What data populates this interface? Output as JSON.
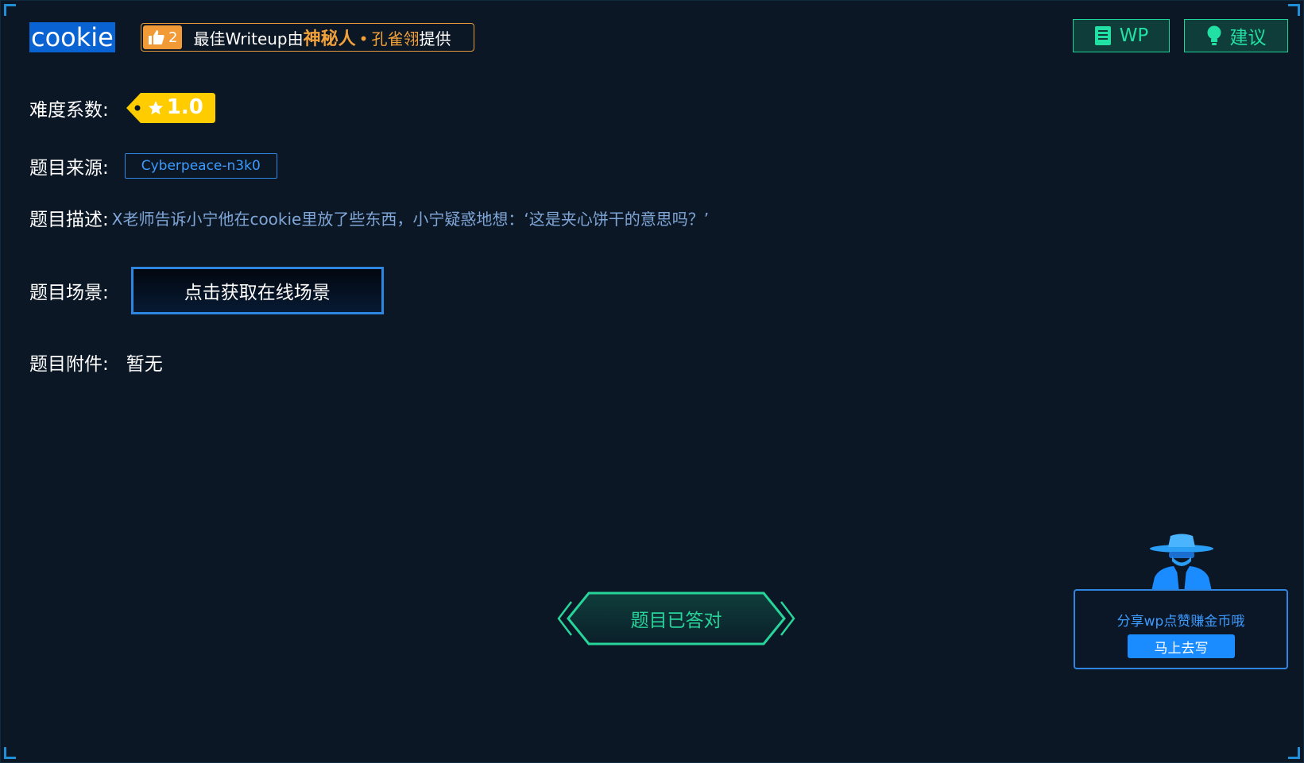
{
  "challenge": {
    "title": "cookie"
  },
  "writeup_banner": {
    "likes": "2",
    "prefix": "最佳Writeup由",
    "author": "神秘人",
    "separator": "•",
    "team": "孔雀翎",
    "suffix": "提供"
  },
  "toolbar": {
    "wp_label": "WP",
    "suggest_label": "建议"
  },
  "fields": {
    "difficulty_label": "难度系数:",
    "difficulty_value": "1.0",
    "source_label": "题目来源:",
    "source_value": "Cyberpeace-n3k0",
    "description_label": "题目描述:",
    "description_value": "X老师告诉小宁他在cookie里放了些东西，小宁疑惑地想：‘这是夹心饼干的意思吗？’",
    "scene_label": "题目场景:",
    "scene_button": "点击获取在线场景",
    "attachment_label": "题目附件:",
    "attachment_value": "暂无"
  },
  "status": {
    "solved_label": "题目已答对"
  },
  "promo": {
    "text": "分享wp点赞赚金币哦",
    "button": "马上去写"
  },
  "colors": {
    "background": "#0c1726",
    "accent_blue": "#2f86e0",
    "accent_green": "#22e0a3",
    "accent_orange": "#f29a36",
    "difficulty_yellow": "#ffcc00"
  }
}
